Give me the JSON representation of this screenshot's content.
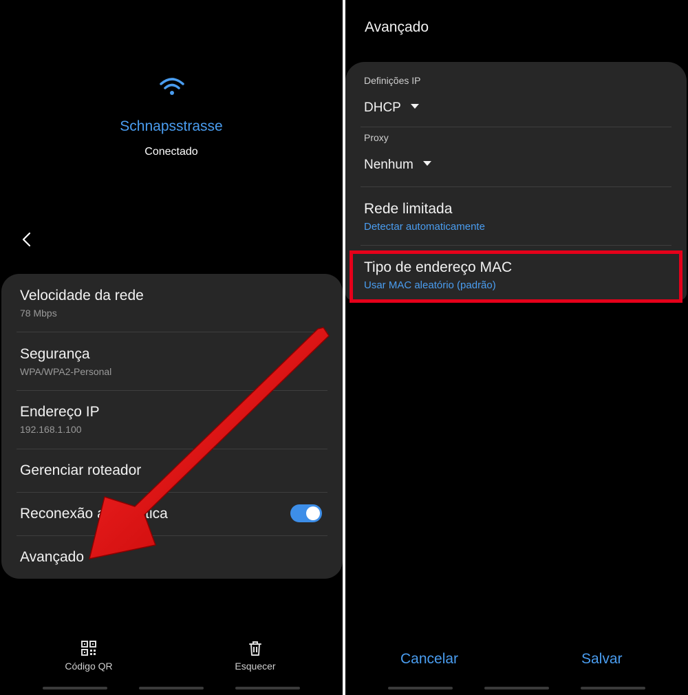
{
  "left": {
    "network": {
      "ssid": "Schnapsstrasse",
      "status": "Conectado",
      "icon": "wifi-icon"
    },
    "back_icon": "chevron-left-icon",
    "details": [
      {
        "title": "Velocidade da rede",
        "subtitle": "78 Mbps"
      },
      {
        "title": "Segurança",
        "subtitle": "WPA/WPA2-Personal"
      },
      {
        "title": "Endereço IP",
        "subtitle": "192.168.1.100"
      }
    ],
    "manage_router": "Gerenciar roteador",
    "auto_reconnect": {
      "label": "Reconexão automática",
      "enabled": true
    },
    "advanced": "Avançado",
    "bottom_actions": {
      "qr_code": "Código QR",
      "forget": "Esquecer"
    }
  },
  "right": {
    "title": "Avançado",
    "ip_settings": {
      "label": "Definições IP",
      "value": "DHCP"
    },
    "proxy": {
      "label": "Proxy",
      "value": "Nenhum"
    },
    "metered": {
      "title": "Rede limitada",
      "subtitle": "Detectar automaticamente"
    },
    "mac_type": {
      "title": "Tipo de endereço MAC",
      "subtitle": "Usar MAC aleatório (padrão)"
    },
    "cancel": "Cancelar",
    "save": "Salvar"
  },
  "colors": {
    "accent": "#4a9df0",
    "card": "#272727",
    "background": "#000000",
    "annotation_red": "#e5001a"
  }
}
